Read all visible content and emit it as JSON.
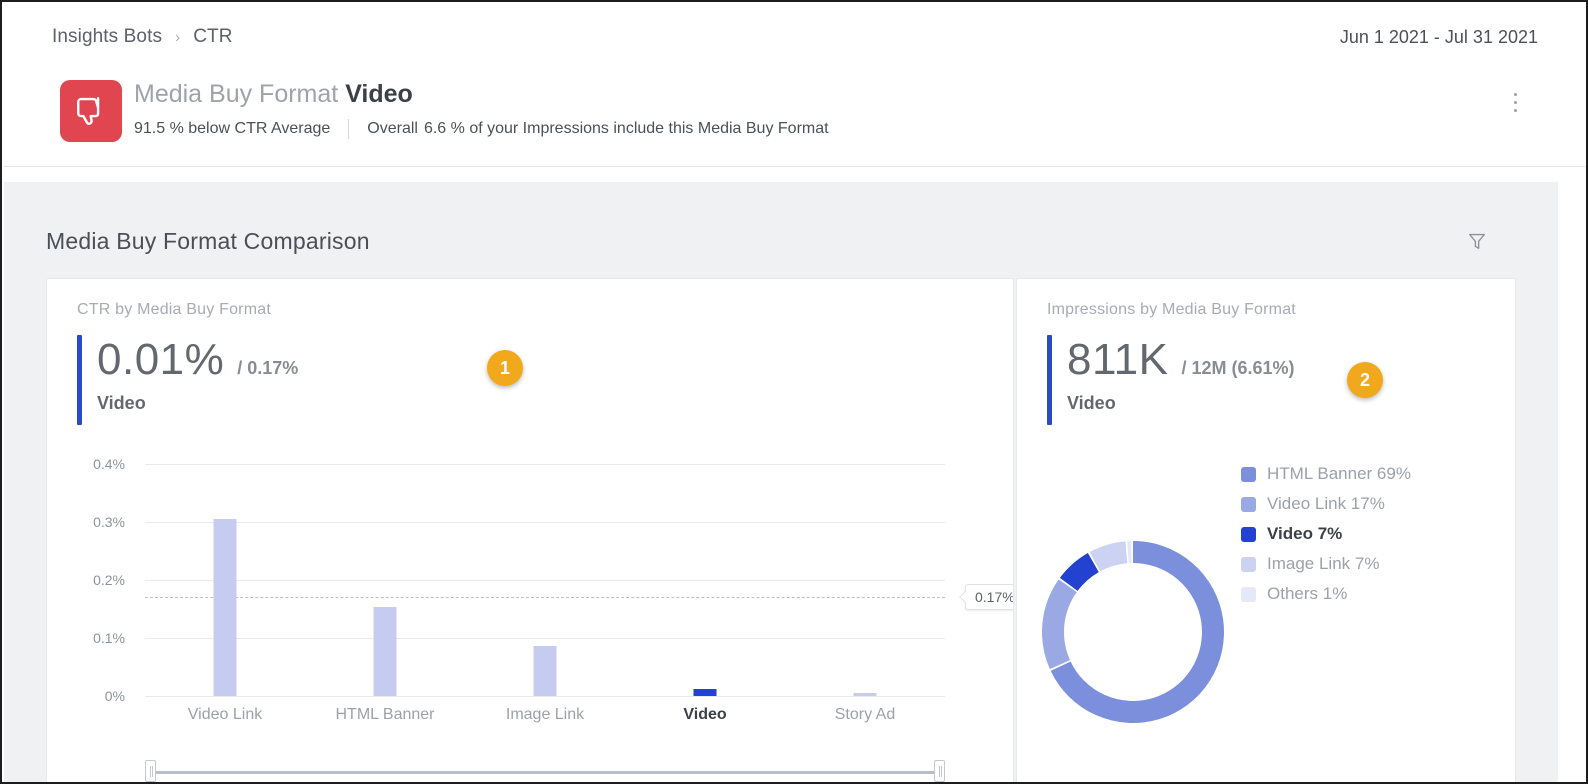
{
  "header": {
    "breadcrumb": [
      "Insights Bots",
      "CTR"
    ],
    "breadcrumb_separator": "›",
    "date_range": "Jun 1 2021 - Jul 31 2021",
    "insight_icon": "thumbs-down-icon",
    "insight_icon_color": "#e14550",
    "title_prefix": "Media Buy Format",
    "title_value": "Video",
    "subtitle_primary": "91.5 % below CTR Average",
    "subtitle_secondary_label": "Overall",
    "subtitle_secondary_value": "6.6 % of your Impressions include this Media Buy Format",
    "menu_icon": "kebab-menu-icon"
  },
  "section": {
    "title": "Media Buy Format Comparison",
    "filter_icon": "filter-funnel-icon"
  },
  "left_card": {
    "label": "CTR by Media Buy Format",
    "kpi_main": "0.01%",
    "kpi_sub": "/ 0.17%",
    "kpi_name": "Video",
    "badge": "1",
    "accent_color": "#2b4ac7",
    "badge_color": "#f2a81d"
  },
  "right_card": {
    "label": "Impressions by Media Buy Format",
    "kpi_main": "811K",
    "kpi_sub": "/ 12M (6.61%)",
    "kpi_name": "Video",
    "badge": "2",
    "accent_color": "#2b4ac7",
    "badge_color": "#f2a81d"
  },
  "chart_data": [
    {
      "type": "bar",
      "title": "CTR by Media Buy Format",
      "categories": [
        "Video Link",
        "HTML Banner",
        "Image Link",
        "Video",
        "Story Ad"
      ],
      "values": [
        0.305,
        0.153,
        0.086,
        0.012,
        0.006
      ],
      "value_labels": [
        "0.305%",
        "0.153%",
        "0.086%",
        "0.012%",
        "0.006%"
      ],
      "selected_category": "Video",
      "xlabel": "",
      "ylabel": "",
      "ylim": [
        0,
        0.4
      ],
      "yticks": [
        0,
        0.1,
        0.2,
        0.3,
        0.4
      ],
      "ytick_labels": [
        "0%",
        "0.1%",
        "0.2%",
        "0.3%",
        "0.4%"
      ],
      "grid": true,
      "legend": "none",
      "average_line": {
        "value": 0.17,
        "label": "0.17%",
        "style": "dashed"
      },
      "bar_color": "#c5ccf0",
      "selected_bar_color": "#2242cf",
      "has_range_brush": true
    },
    {
      "type": "pie",
      "title": "Impressions by Media Buy Format",
      "donut": true,
      "legend_position": "right",
      "labels": [
        "HTML Banner",
        "Video Link",
        "Video",
        "Image Link",
        "Others"
      ],
      "values": [
        69,
        17,
        7,
        7,
        1
      ],
      "value_labels": [
        "69%",
        "17%",
        "7%",
        "7%",
        "1%"
      ],
      "colors": [
        "#7b8fdc",
        "#9aa9e4",
        "#2242cf",
        "#ccd3f2",
        "#e4e8f8"
      ],
      "selected_label": "Video",
      "legend_entries": [
        {
          "label": "HTML Banner",
          "value": "69%",
          "color": "#7b8fdc",
          "selected": false
        },
        {
          "label": "Video Link",
          "value": "17%",
          "color": "#9aa9e4",
          "selected": false
        },
        {
          "label": "Video",
          "value": "7%",
          "color": "#2242cf",
          "selected": true
        },
        {
          "label": "Image Link",
          "value": "7%",
          "color": "#ccd3f2",
          "selected": false
        },
        {
          "label": "Others",
          "value": "1%",
          "color": "#e4e8f8",
          "selected": false
        }
      ]
    }
  ]
}
